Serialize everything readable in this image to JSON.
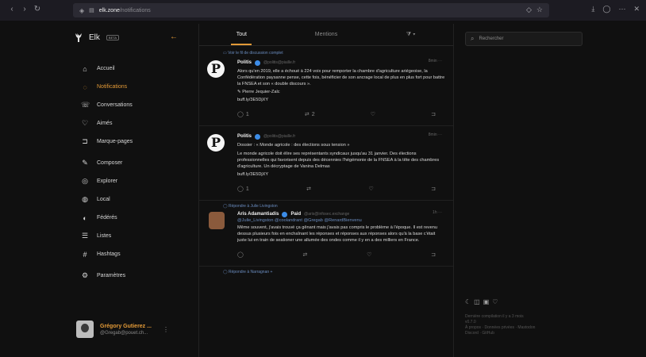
{
  "browser": {
    "url_host": "elk.zone",
    "url_path": "/notifications"
  },
  "sidebar": {
    "brand": "Elk",
    "brand_badge": "BETA",
    "items": [
      {
        "label": "Accueil",
        "icon": "home-icon",
        "glyph": "⌂"
      },
      {
        "label": "Notifications",
        "icon": "bell-icon",
        "glyph": "◌",
        "active": true
      },
      {
        "label": "Conversations",
        "icon": "chat-icon",
        "glyph": "☏"
      },
      {
        "label": "Aimés",
        "icon": "heart-icon",
        "glyph": "♡"
      },
      {
        "label": "Marque-pages",
        "icon": "bookmark-icon",
        "glyph": "⊐"
      },
      {
        "label": "Composer",
        "icon": "pen-icon",
        "glyph": "✎"
      },
      {
        "label": "Explorer",
        "icon": "compass-icon",
        "glyph": "◎"
      },
      {
        "label": "Local",
        "icon": "group-icon",
        "glyph": "◍"
      },
      {
        "label": "Fédérés",
        "icon": "globe-icon",
        "glyph": "◐"
      },
      {
        "label": "Listes",
        "icon": "list-icon",
        "glyph": "☰"
      },
      {
        "label": "Hashtags",
        "icon": "hashtag-icon",
        "glyph": "#"
      },
      {
        "label": "Paramètres",
        "icon": "settings-icon",
        "glyph": "⚙"
      }
    ],
    "user": {
      "name": "Grégory Gutierez ...",
      "handle": "@Gregab@pouet.ch..."
    }
  },
  "main": {
    "tabs": [
      "Tout",
      "Mentions",
      ""
    ],
    "thread_link": "Voir le fil de discussion complet",
    "posts": [
      {
        "author": "Politis",
        "handle": "@politis@piaille.fr",
        "time": "8min",
        "body": "Alors qu'en 2019, elle a échoué à 224 voix pour remporter la chambre d'agriculture ariégeoise, la Confédération paysanne pense, cette fois, bénéficier de son ancrage local de plus en plus fort pour battre la FNSEA et son « double discours ».",
        "byline": "✎ Pierre Jequier-Zalc",
        "link": "buff.ly/3E5DjXY",
        "replies": "1",
        "boosts": "2"
      },
      {
        "author": "Politis",
        "handle": "@politis@piaille.fr",
        "time": "8min",
        "body": "Dossier : « Monde agricole : des élections sous tension »",
        "body2": "Le monde agricole doit élire ses représentants syndicaux jusqu'au 31 janvier. Des élections professionnelles qui favorisent depuis des décennies l'hégémonie de la FNSEA à la tête des chambres d'agriculture. Un décryptage de Vanina Delmas",
        "link": "buff.ly/3E5DjXY",
        "replies": "1"
      },
      {
        "reply_to": "Répondre à  Julie Livingston",
        "author": "Aris Adamantiadis",
        "suffix": "Paid",
        "handle": "@aris@infosec.exchange",
        "time": "1h",
        "mentions": "@Julie_Livingston @coolandrant @Gregab @RenardBienvenu",
        "body": "Même souvent, j'avais trouvé ça gênant mais j'avais pas compris le problème à l'époque. Il est revenu dessus plusieurs fois en enchaînant les réponses et réponses aux réponses alors qu'à la base c'était juste lui en train de seationer une allumée des ondes comme il y en a des milliers en France."
      }
    ],
    "bottom_reply": "Répondre à  Narragnan +"
  },
  "right": {
    "search_placeholder": "Rechercher",
    "footer": [
      "Dernière compilation il y a 3 mois",
      "v0.7.0",
      "À propos · Données privées · Mastodon",
      "Discord · GitHub"
    ]
  },
  "colors": {
    "accent": "#e39a37",
    "link": "#6a8cbf",
    "verified": "#3c8ce7"
  }
}
